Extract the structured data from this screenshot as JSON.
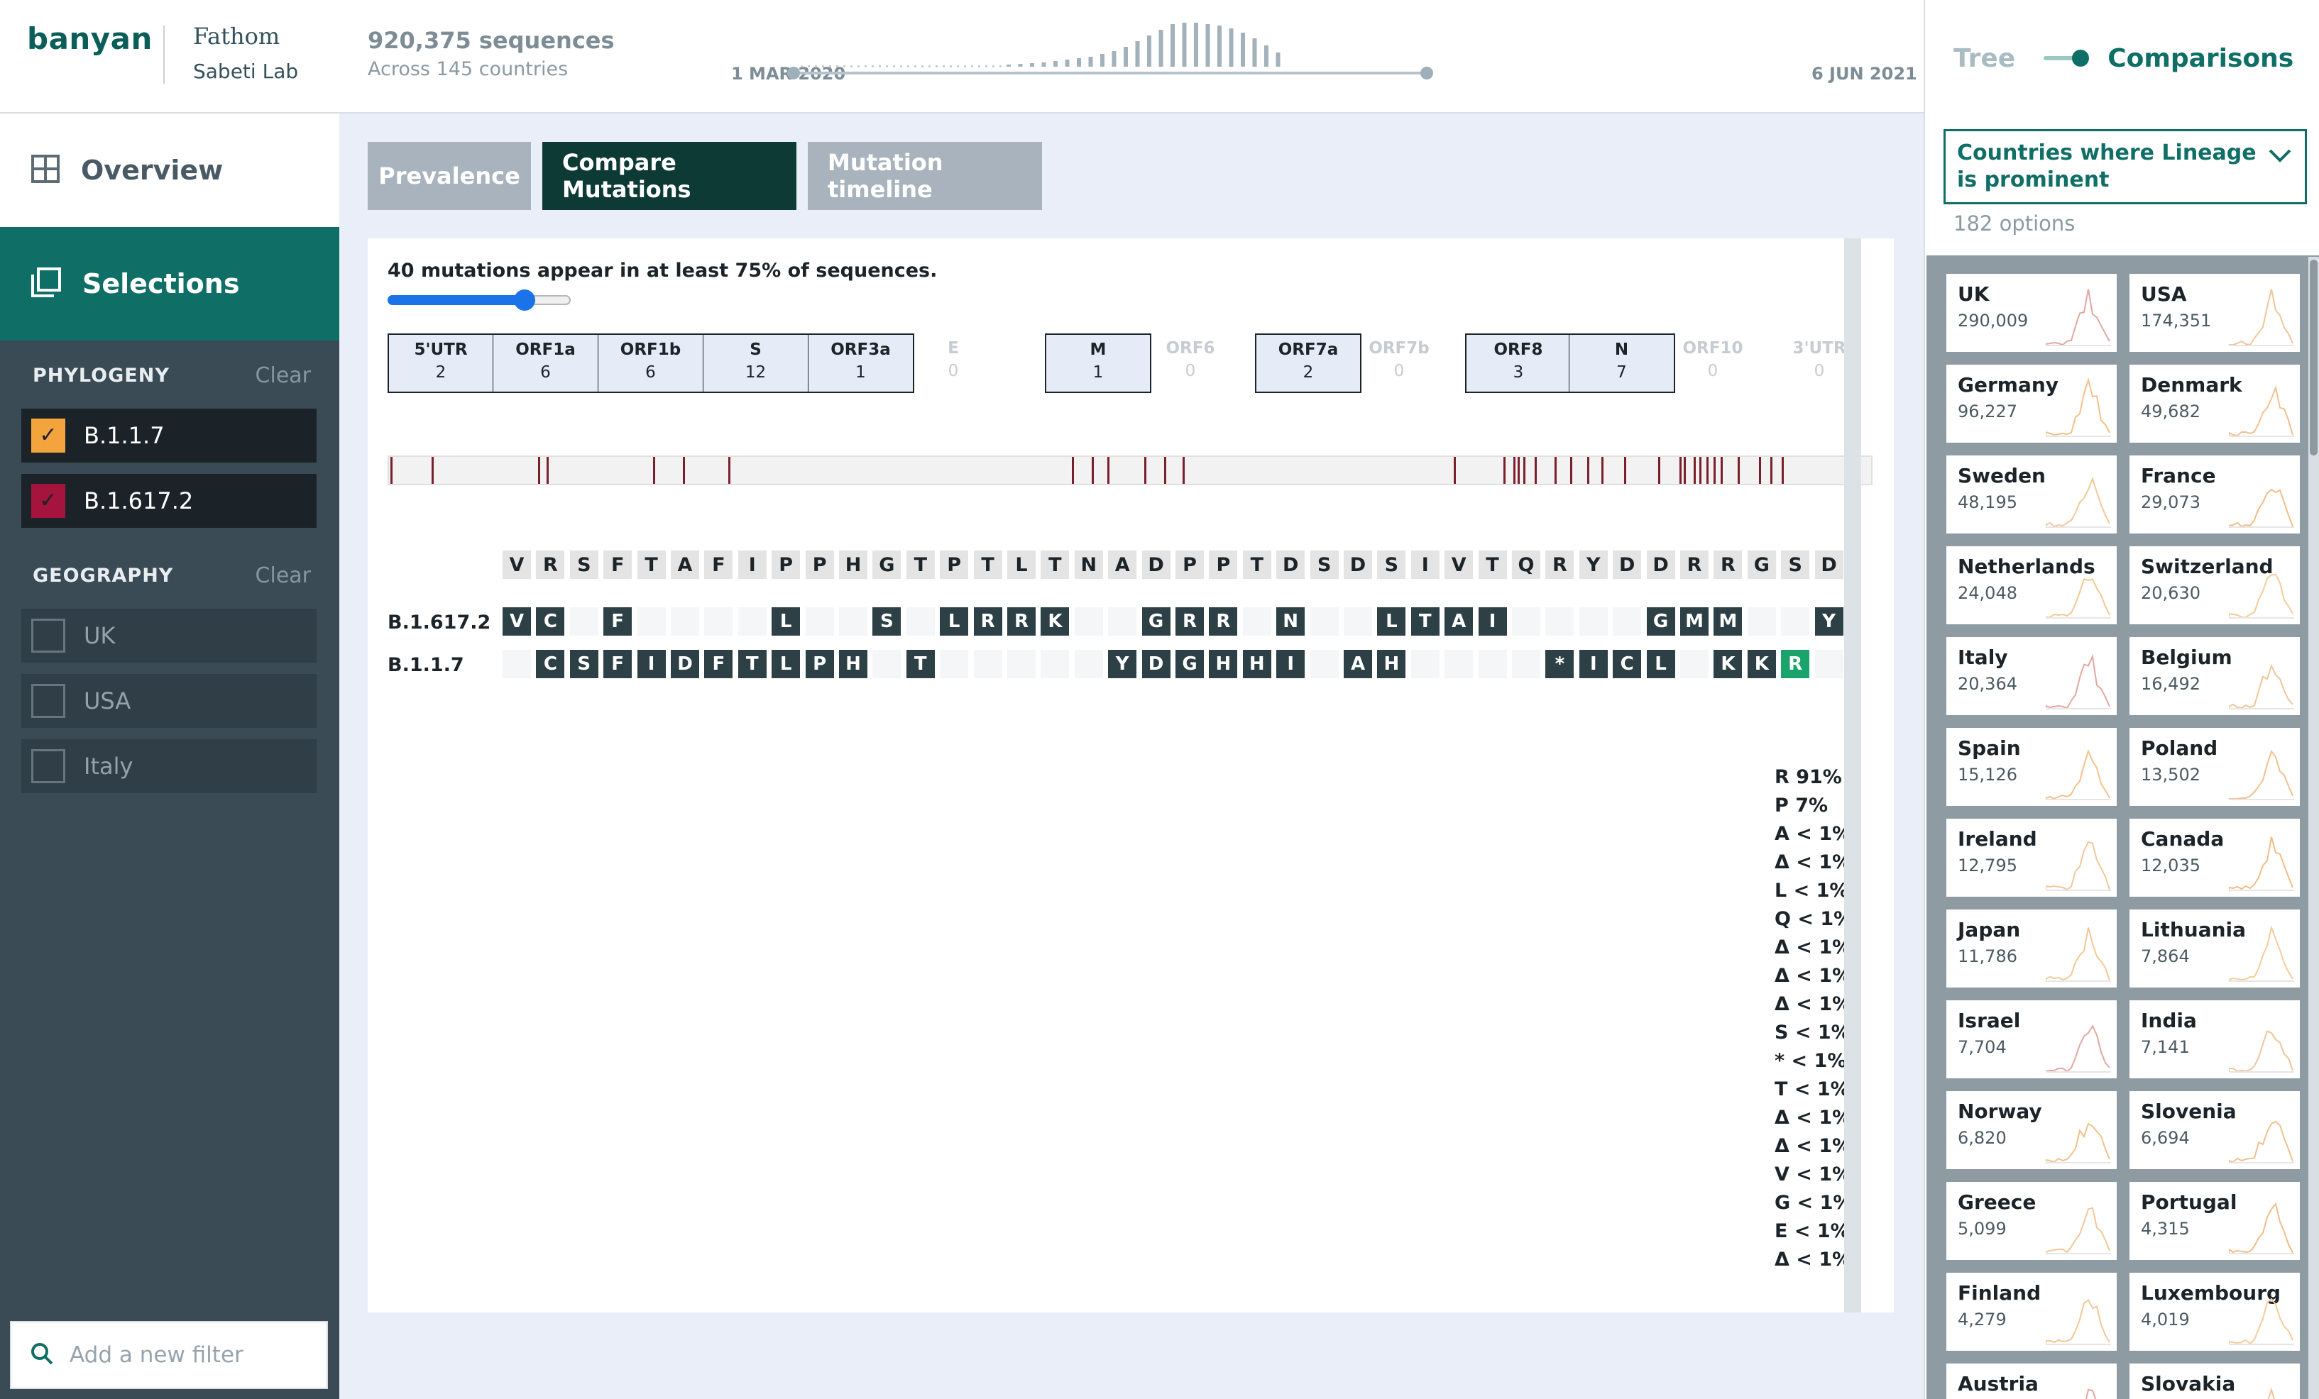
{
  "brand": {
    "logo": "banyan",
    "org_line1": "Fathom",
    "org_line2": "Sabeti Lab"
  },
  "nav": {
    "overview": "Overview",
    "selections": "Selections"
  },
  "phylogeny": {
    "title": "PHYLOGENY",
    "clear": "Clear",
    "items": [
      {
        "label": "B.1.1.7",
        "checked": true,
        "color": "#f4a43c"
      },
      {
        "label": "B.1.617.2",
        "checked": true,
        "color": "#a4143d"
      }
    ]
  },
  "geography": {
    "title": "GEOGRAPHY",
    "clear": "Clear",
    "items": [
      {
        "label": "UK",
        "checked": false
      },
      {
        "label": "USA",
        "checked": false
      },
      {
        "label": "Italy",
        "checked": false
      }
    ]
  },
  "add_filter": {
    "placeholder": "Add a new filter"
  },
  "header": {
    "sequences": "920,375 sequences",
    "countries": "Across 145 countries",
    "date_start": "1 MAR 2020",
    "date_end": "6 JUN 2021"
  },
  "right_panel": {
    "toggle_tree": "Tree",
    "toggle_comparisons": "Comparisons",
    "select_label": "Countries where Lineage is prominent",
    "options_count": "182 options",
    "countries": [
      {
        "name": "UK",
        "count": "290,009"
      },
      {
        "name": "USA",
        "count": "174,351"
      },
      {
        "name": "Germany",
        "count": "96,227"
      },
      {
        "name": "Denmark",
        "count": "49,682"
      },
      {
        "name": "Sweden",
        "count": "48,195"
      },
      {
        "name": "France",
        "count": "29,073"
      },
      {
        "name": "Netherlands",
        "count": "24,048"
      },
      {
        "name": "Switzerland",
        "count": "20,630"
      },
      {
        "name": "Italy",
        "count": "20,364"
      },
      {
        "name": "Belgium",
        "count": "16,492"
      },
      {
        "name": "Spain",
        "count": "15,126"
      },
      {
        "name": "Poland",
        "count": "13,502"
      },
      {
        "name": "Ireland",
        "count": "12,795"
      },
      {
        "name": "Canada",
        "count": "12,035"
      },
      {
        "name": "Japan",
        "count": "11,786"
      },
      {
        "name": "Lithuania",
        "count": "7,864"
      },
      {
        "name": "Israel",
        "count": "7,704"
      },
      {
        "name": "India",
        "count": "7,141"
      },
      {
        "name": "Norway",
        "count": "6,820"
      },
      {
        "name": "Slovenia",
        "count": "6,694"
      },
      {
        "name": "Greece",
        "count": "5,099"
      },
      {
        "name": "Portugal",
        "count": "4,315"
      },
      {
        "name": "Finland",
        "count": "4,279"
      },
      {
        "name": "Luxembourg",
        "count": "4,019"
      },
      {
        "name": "Austria",
        "count": ""
      },
      {
        "name": "Slovakia",
        "count": ""
      }
    ]
  },
  "tabs": {
    "prevalence": "Prevalence",
    "compare": "Compare Mutations",
    "timeline": "Mutation timeline"
  },
  "compare": {
    "summary": "40 mutations appear in at least 75% of sequences.",
    "threshold_pct": 75,
    "genes": [
      {
        "name": "5'UTR",
        "count": "2",
        "active": true
      },
      {
        "name": "ORF1a",
        "count": "6",
        "active": true
      },
      {
        "name": "ORF1b",
        "count": "6",
        "active": true
      },
      {
        "name": "S",
        "count": "12",
        "active": true
      },
      {
        "name": "ORF3a",
        "count": "1",
        "active": true
      },
      {
        "name": "E",
        "count": "0",
        "active": false
      },
      {
        "name": "M",
        "count": "1",
        "active": true
      },
      {
        "name": "ORF6",
        "count": "0",
        "active": false
      },
      {
        "name": "ORF7a",
        "count": "2",
        "active": true
      },
      {
        "name": "ORF7b",
        "count": "0",
        "active": false
      },
      {
        "name": "ORF8",
        "count": "3",
        "active": true
      },
      {
        "name": "N",
        "count": "7",
        "active": true
      },
      {
        "name": "ORF10",
        "count": "0",
        "active": false
      },
      {
        "name": "3'UTR",
        "count": "0",
        "active": false
      }
    ],
    "reference": [
      "V",
      "R",
      "S",
      "F",
      "T",
      "A",
      "F",
      "I",
      "P",
      "P",
      "H",
      "G",
      "T",
      "P",
      "T",
      "L",
      "T",
      "N",
      "A",
      "D",
      "P",
      "P",
      "T",
      "D",
      "S",
      "D",
      "S",
      "I",
      "V",
      "T",
      "Q",
      "R",
      "Y",
      "D",
      "D",
      "R",
      "R",
      "G",
      "S",
      "D"
    ],
    "lineages": [
      {
        "label": "B.1.617.2",
        "cells": [
          "V",
          "C",
          "",
          "F",
          "",
          "",
          "",
          "",
          "L",
          "",
          "",
          "S",
          "",
          "L",
          "R",
          "R",
          "K",
          "",
          "",
          "G",
          "R",
          "R",
          "",
          "N",
          "",
          "",
          "L",
          "T",
          "A",
          "I",
          "",
          "",
          "",
          "",
          "G",
          "M",
          "M",
          "",
          "",
          "Y"
        ]
      },
      {
        "label": "B.1.1.7",
        "cells": [
          "",
          "C",
          "S",
          "F",
          "I",
          "D",
          "F",
          "T",
          "L",
          "P",
          "H",
          "",
          "T",
          "",
          "",
          "",
          "",
          "",
          "Y",
          "D",
          "G",
          "H",
          "H",
          "I",
          "",
          "A",
          "H",
          "",
          "",
          "",
          "",
          "*",
          "I",
          "C",
          "L",
          "",
          "K",
          "K",
          "R",
          ""
        ]
      }
    ],
    "frequencies": [
      "R 91%",
      "P 7%",
      "A < 1%",
      "Δ < 1%",
      "L < 1%",
      "Q < 1%",
      "Δ < 1%",
      "Δ < 1%",
      "Δ < 1%",
      "S < 1%",
      "* < 1%",
      "T < 1%",
      "Δ < 1%",
      "Δ < 1%",
      "V < 1%",
      "G < 1%",
      "E < 1%",
      "Δ < 1%"
    ]
  }
}
